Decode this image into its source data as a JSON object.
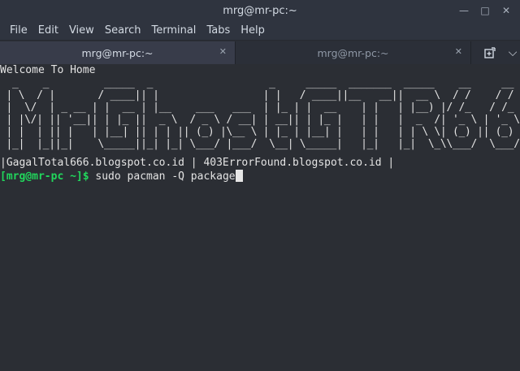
{
  "window": {
    "title": "mrg@mr-pc:~",
    "controls": [
      "minimize-icon",
      "maximize-icon",
      "close-icon"
    ]
  },
  "menu": [
    "File",
    "Edit",
    "View",
    "Search",
    "Terminal",
    "Tabs",
    "Help"
  ],
  "tabs": [
    {
      "label": "mrg@mr-pc:~",
      "active": true
    },
    {
      "label": "mrg@mr-pc:~",
      "active": false
    }
  ],
  "terminal": {
    "welcome": "Welcome To Home",
    "ascii_art": [
      "  _    _         _____  _                   _     _____  _______  _____    __     __     __  ",
      " | \\  / |       / ____|| |                 | |   / ____||__   __||  __ \\  / /    / /    / /  ",
      " |  \\/  | _ __ | |  __ | |__    ___   ___  | |_ | |  __    | |   | |__) |/ /_   / /_   / /_  ",
      " | |\\/| || '__|| | |_ ||  _ \\  / _ \\ / __| | __|| | |_ |   | |   |  _  /| '_ \\ | '_ \\ | '_ \\ ",
      " | |  | || |   | |__| || | | || (_) |\\__ \\ | |_ | |__| |   | |   | | \\ \\| (_) || (_) || (_) |",
      " |_|  |_||_|    \\_____||_| |_| \\___/ |___/  \\__| \\_____|   |_|   |_|  \\_\\\\___/  \\___/  \\___/ "
    ],
    "links_line": "|GagalTotal666.blogspot.co.id | 403ErrorFound.blogspot.co.id |",
    "prompt": "[mrg@mr-pc ~]$",
    "command": " sudo pacman -Q package"
  },
  "colors": {
    "background": "#2b2e34",
    "prompt": "#21d65c",
    "chrome": "#2f343f"
  }
}
